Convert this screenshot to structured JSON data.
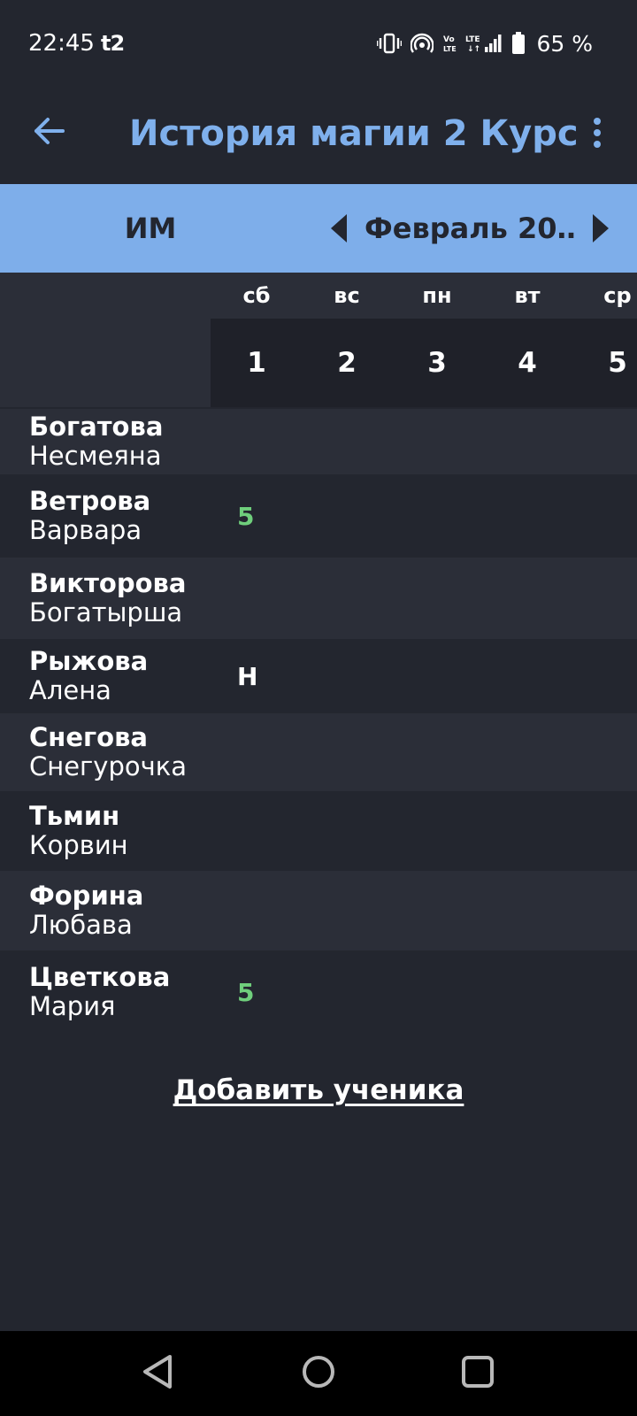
{
  "status_bar": {
    "time": "22:45",
    "carrier": "t2",
    "battery": "65 %",
    "icons": [
      "vibrate-icon",
      "hotspot-icon",
      "volte-icon",
      "lte-icon",
      "signal-icon",
      "battery-icon"
    ]
  },
  "app_bar": {
    "title": "История магии 2 Курс",
    "back_icon": "arrow-left-icon",
    "menu_icon": "more-vertical-icon"
  },
  "sub_bar": {
    "subject": "ИМ",
    "month": "Февраль 20…"
  },
  "days": [
    {
      "dow": "сб",
      "num": "1"
    },
    {
      "dow": "вс",
      "num": "2"
    },
    {
      "dow": "пн",
      "num": "3"
    },
    {
      "dow": "вт",
      "num": "4"
    },
    {
      "dow": "ср",
      "num": "5"
    }
  ],
  "students": [
    {
      "surname": "Богатова",
      "name": "Несмеяна",
      "grades": [
        "",
        "",
        "",
        "",
        ""
      ]
    },
    {
      "surname": "Ветрова",
      "name": "Варвара",
      "grades": [
        "5",
        "",
        "",
        "",
        ""
      ]
    },
    {
      "surname": "Викторова",
      "name": "Богатырша",
      "grades": [
        "",
        "",
        "",
        "",
        ""
      ]
    },
    {
      "surname": "Рыжова",
      "name": "Алена",
      "grades": [
        "Н",
        "",
        "",
        "",
        ""
      ]
    },
    {
      "surname": "Снегова",
      "name": "Снегурочка",
      "grades": [
        "",
        "",
        "",
        "",
        ""
      ]
    },
    {
      "surname": "Тьмин",
      "name": "Корвин",
      "grades": [
        "",
        "",
        "",
        "",
        ""
      ]
    },
    {
      "surname": "Форина",
      "name": "Любава",
      "grades": [
        "",
        "",
        "",
        "",
        ""
      ]
    },
    {
      "surname": "Цветкова",
      "name": "Мария",
      "grades": [
        "5",
        "",
        "",
        "",
        ""
      ]
    }
  ],
  "add_student_label": "Добавить ученика",
  "colors": {
    "accent": "#7fb0ec",
    "header_bar": "#7eaeea",
    "grade_good": "#6fcf7c",
    "background": "#23262f"
  }
}
